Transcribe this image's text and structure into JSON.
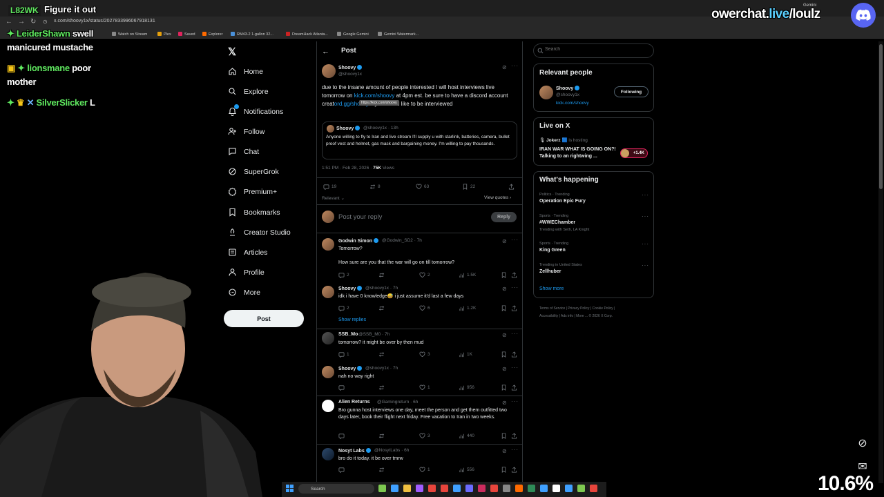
{
  "stream": {
    "top_user": "L82WK",
    "top_msg": "Figure it out",
    "brand_prefix": "owerchat.",
    "brand_accent": "live",
    "brand_suffix": "/loulz",
    "percent": "10.6%",
    "chat": [
      {
        "user": "LeiderShawn",
        "msg": "swell"
      },
      {
        "user": "",
        "msg": "manicured mustache"
      },
      {
        "user": "lionsmane",
        "msg": "poor"
      },
      {
        "user": "",
        "msg": "mother"
      },
      {
        "user": "SilverSlicker",
        "msg": "L"
      }
    ]
  },
  "browser": {
    "url": "x.com/shoovy1x/status/2027833996067918131",
    "bookmarks": [
      "Watch on Stream",
      "Plex",
      "Saved",
      "Explorer",
      "RM43-2 1-gallon 32...",
      "DreamHack Atlanta...",
      "Google Gemini",
      "Gemini Watermark..."
    ],
    "bookmark_colors": [
      "#888888",
      "#e5a00d",
      "#e0245e",
      "#ff6a00",
      "#4a90d9",
      "#cc2222",
      "#888888",
      "#888888"
    ],
    "gemini_tab": "Gemini"
  },
  "nav": {
    "items": [
      "Home",
      "Explore",
      "Notifications",
      "Follow",
      "Chat",
      "SuperGrok",
      "Premium+",
      "Bookmarks",
      "Creator Studio",
      "Articles",
      "Profile",
      "More"
    ],
    "post_button": "Post"
  },
  "post": {
    "header": "Post",
    "author": "Shoovy",
    "handle": "@shoovy1x",
    "text_1": "due to the insane amount of people interested I will host interviews live tomorrow on ",
    "link_1": "kick.com/shoovy",
    "text_2": " at 4pm est. be sure to have a discord account creat",
    "link_2": "ord.gg/shoovy",
    "text_3": " if you would like to be interviewed",
    "tooltip": "https://kick.com/shoovy",
    "quote_author": "Shoovy",
    "quote_handle": "@shoovy1x · 13h",
    "quote_text": "Anyone willing to fly to Iran and live stream I'll supply u with starlink, batteries, camera, bullet proof vest and helmet, gas mask and bargaining money. I'm willing to pay thousands.",
    "timestamp": "1:51 PM · Feb 28, 2026 · ",
    "views": "75K",
    "views_label": " Views",
    "replies": "19",
    "reposts": "8",
    "likes": "63",
    "bookmarks": "22",
    "relevant": "Relevant",
    "view_quotes": "View quotes",
    "reply_placeholder": "Post your reply",
    "reply_button": "Reply"
  },
  "replies": [
    {
      "author": "Godwin Simon",
      "handle": "@Godwin_SD2 · 7h",
      "line1": "Tomorrow?",
      "line2": "How sure are you that the war will go on  till tomorrow?",
      "replies": "2",
      "reposts": "",
      "likes": "2",
      "views": "1.5K"
    },
    {
      "author": "Shoovy",
      "handle": "@shoovy1x · 7h",
      "line1": "idk i have 0 knowledge😅 i just assume it'd last a few days",
      "replies": "2",
      "reposts": "",
      "likes": "6",
      "views": "1.2K"
    },
    {
      "author": "SSB_Mo",
      "handle": "@SSB_M0 · 7h",
      "line1": "tomorrow? it might be over by then mud",
      "replies": "1",
      "reposts": "",
      "likes": "3",
      "views": "1K"
    },
    {
      "author": "Shoovy",
      "handle": "@shoovy1x · 7h",
      "line1": "nah no way right",
      "replies": "",
      "reposts": "",
      "likes": "1",
      "views": "956"
    },
    {
      "author": "Alien Returns",
      "handle": "@Gamingreturn · 6h",
      "line1": "Bro gunna host interviews one day, meet the person and get them outfitted two days later, book their flight next friday. Free vacation to Iran in two weeks.",
      "replies": "",
      "reposts": "",
      "likes": "3",
      "views": "440"
    },
    {
      "author": "Nosyt Labs",
      "handle": "@NosytLabs · 6h",
      "line1": "bro do it today. it be over tmrw",
      "replies": "",
      "reposts": "",
      "likes": "1",
      "views": "556"
    }
  ],
  "show_replies": "Show replies",
  "right": {
    "search_placeholder": "Search",
    "relevant_title": "Relevant people",
    "rel_name": "Shoovy",
    "rel_handle": "@shoovy1x",
    "rel_link": "kick.com/shoovy",
    "following": "Following",
    "live_title": "Live on X",
    "live_host": "Jokerz",
    "live_hosting": "is hosting",
    "live_text": "IRAN WAR WHAT IS GOING ON?! Talking to an rightwing ...",
    "live_count": "+1.4K",
    "happening_title": "What's happening",
    "trends": [
      {
        "cat": "Politics · Trending",
        "name": "Operation Epic Fury",
        "extra": ""
      },
      {
        "cat": "Sports · Trending",
        "name": "#WWEChamber",
        "extra": "Trending with Seth, LA Knight"
      },
      {
        "cat": "Sports · Trending",
        "name": "King Green",
        "extra": ""
      },
      {
        "cat": "Trending in United States",
        "name": "Zellhuber",
        "extra": ""
      }
    ],
    "show_more": "Show more",
    "footer1": "Terms of Service  |  Privacy Policy  |  Cookie Policy  |",
    "footer2": "Accessibility  |  Ads info  |  More ...  © 2026 X Corp."
  },
  "taskbar": {
    "search": "Search"
  },
  "colors": {
    "accent": "#1d9bf0",
    "bg": "#000000",
    "border": "#2f3336",
    "chat_green": "#5fe85f"
  }
}
